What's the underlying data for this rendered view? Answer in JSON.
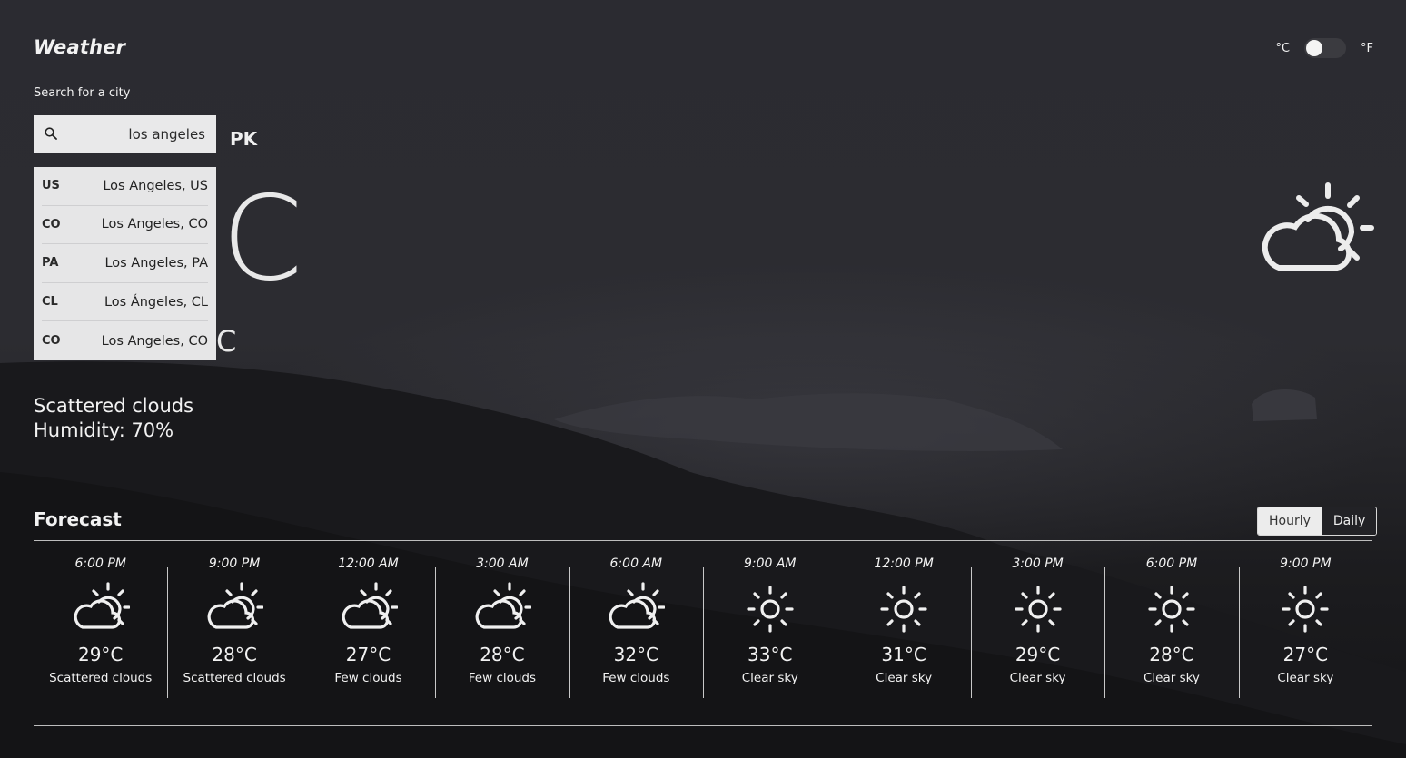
{
  "app": {
    "title": "Weather"
  },
  "units": {
    "celsius_label": "°C",
    "fahrenheit_label": "°F",
    "selected": "celsius"
  },
  "search": {
    "label": "Search for a city",
    "value": "los angeles",
    "current_country_code": "PK",
    "suggestions": [
      {
        "code": "US",
        "name": "Los Angeles, US"
      },
      {
        "code": "CO",
        "name": "Los Angeles, CO"
      },
      {
        "code": "PA",
        "name": "Los Angeles, PA"
      },
      {
        "code": "CL",
        "name": "Los Ángeles, CL"
      },
      {
        "code": "CO",
        "name": "Los Angeles, CO"
      }
    ]
  },
  "current": {
    "temp_fragment": "C",
    "feels_fragment": "C",
    "description": "Scattered clouds",
    "humidity": "Humidity: 70%",
    "icon": "partly-cloudy-sun-icon"
  },
  "forecast": {
    "title": "Forecast",
    "views": {
      "hourly": "Hourly",
      "daily": "Daily",
      "selected": "hourly"
    },
    "items": [
      {
        "time": "6:00 PM",
        "temp": "29°C",
        "desc": "Scattered clouds",
        "icon": "partly-cloudy-icon"
      },
      {
        "time": "9:00 PM",
        "temp": "28°C",
        "desc": "Scattered clouds",
        "icon": "partly-cloudy-icon"
      },
      {
        "time": "12:00 AM",
        "temp": "27°C",
        "desc": "Few clouds",
        "icon": "partly-cloudy-icon"
      },
      {
        "time": "3:00 AM",
        "temp": "28°C",
        "desc": "Few clouds",
        "icon": "partly-cloudy-icon"
      },
      {
        "time": "6:00 AM",
        "temp": "32°C",
        "desc": "Few clouds",
        "icon": "partly-cloudy-icon"
      },
      {
        "time": "9:00 AM",
        "temp": "33°C",
        "desc": "Clear sky",
        "icon": "sun-icon"
      },
      {
        "time": "12:00 PM",
        "temp": "31°C",
        "desc": "Clear sky",
        "icon": "sun-icon"
      },
      {
        "time": "3:00 PM",
        "temp": "29°C",
        "desc": "Clear sky",
        "icon": "sun-icon"
      },
      {
        "time": "6:00 PM",
        "temp": "28°C",
        "desc": "Clear sky",
        "icon": "sun-icon"
      },
      {
        "time": "9:00 PM",
        "temp": "27°C",
        "desc": "Clear sky",
        "icon": "sun-icon"
      }
    ]
  }
}
